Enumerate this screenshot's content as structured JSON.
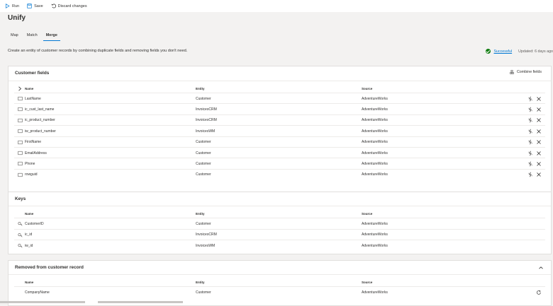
{
  "toolbar": {
    "run": "Run",
    "save": "Save",
    "discard": "Discard changes"
  },
  "page": {
    "title": "Unify",
    "tabs": [
      {
        "label": "Map"
      },
      {
        "label": "Match"
      },
      {
        "label": "Merge"
      }
    ],
    "description": "Create an entity of customer records by combining duplicate fields and removing fields you don't need.",
    "status": {
      "label": "Successful",
      "updated": "Updated: 6 days ago",
      "color": "#107c10"
    }
  },
  "columns": {
    "name": "Name",
    "entity": "Entity",
    "source": "Source"
  },
  "customer_fields": {
    "title": "Customer fields",
    "combine_label": "Combine fields",
    "rows": [
      {
        "name": "LastName",
        "entity": "Customer",
        "source": "AdventureWorks"
      },
      {
        "name": "ic_cust_last_name",
        "entity": "InvoicesCRM",
        "source": "AdventureWorks"
      },
      {
        "name": "ic_product_number",
        "entity": "InvoicesCRM",
        "source": "AdventureWorks"
      },
      {
        "name": "iw_product_number",
        "entity": "InvoicesWM",
        "source": "AdventureWorks"
      },
      {
        "name": "FirstName",
        "entity": "Customer",
        "source": "AdventureWorks"
      },
      {
        "name": "EmailAddress",
        "entity": "Customer",
        "source": "AdventureWorks"
      },
      {
        "name": "Phone",
        "entity": "Customer",
        "source": "AdventureWorks"
      },
      {
        "name": "rowguid",
        "entity": "Customer",
        "source": "AdventureWorks"
      }
    ]
  },
  "keys": {
    "title": "Keys",
    "rows": [
      {
        "name": "CustomerID",
        "entity": "Customer",
        "source": "AdventureWorks"
      },
      {
        "name": "ic_id",
        "entity": "InvoicesCRM",
        "source": "AdventureWorks"
      },
      {
        "name": "iw_id",
        "entity": "InvoicesWM",
        "source": "AdventureWorks"
      }
    ]
  },
  "removed": {
    "title": "Removed from customer record",
    "rows": [
      {
        "name": "CompanyName",
        "entity": "Customer",
        "source": "AdventureWorks"
      }
    ]
  },
  "colors": {
    "accent": "#0078d4",
    "success": "#107c10"
  }
}
